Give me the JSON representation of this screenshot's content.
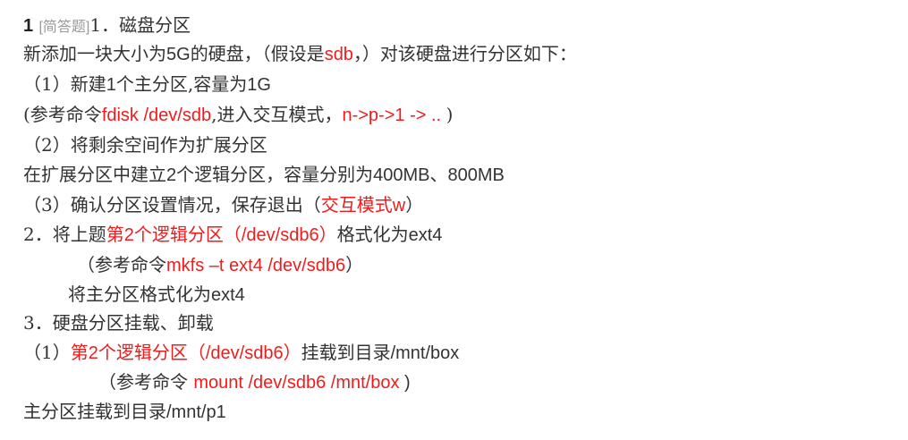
{
  "question": {
    "number": "1",
    "type_label": "[简答题]"
  },
  "lines": [
    [
      "1．磁盘分区"
    ],
    [
      "新添加一块大小为",
      "5G",
      "的硬盘，（假设是",
      "sdb",
      "，）对该硬盘进行分区如下："
    ],
    [
      "（1）新建",
      "1",
      "个主分区,容量为",
      "1G"
    ],
    [
      "(参考命令",
      "fdisk  /dev/sdb",
      ",进入交互模式，",
      "n->p->1 -> .. ",
      ")"
    ],
    [
      "（2）将剩余空间作为扩展分区"
    ],
    [
      "在扩展分区中建立",
      "2",
      "个逻辑分区，容量分别为",
      "400MB",
      "、",
      "800MB"
    ],
    [
      "（3）确认分区设置情况，保存退出（",
      "交互模式w",
      "）"
    ],
    [
      "2．将上题",
      "第2个逻辑分区（/dev/sdb6）",
      "格式化为",
      "ext4"
    ],
    [
      "（参考命令",
      "mkfs  –t  ext4  /dev/sdb6",
      "）"
    ],
    [
      "将主分区格式化为",
      "ext4"
    ],
    [
      "3．硬盘分区挂载、卸载"
    ],
    [
      "（1）",
      "第2个逻辑分区（/dev/sdb6）",
      "挂载到目录",
      "/mnt/box"
    ],
    [
      "（参考命令  ",
      "mount  /dev/sdb6  /mnt/box",
      " )"
    ],
    [
      "主分区挂载到目录",
      "/mnt/p1"
    ]
  ]
}
